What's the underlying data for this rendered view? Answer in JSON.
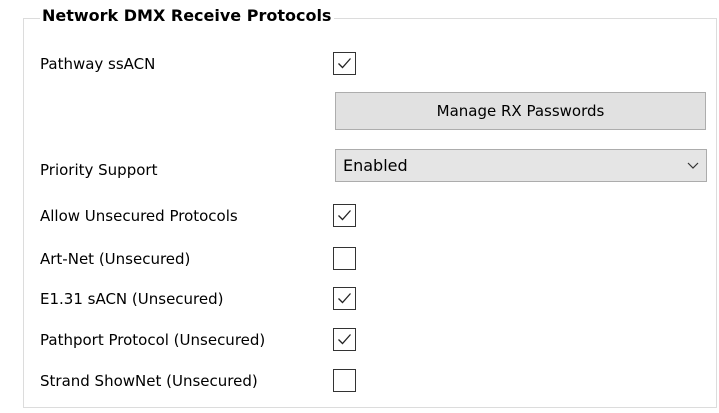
{
  "group": {
    "title": "Network DMX Receive Protocols"
  },
  "rows": {
    "pathway_ssacn": {
      "label": "Pathway ssACN",
      "checked": true
    },
    "manage_rx_passwords": {
      "label": "Manage RX Passwords"
    },
    "priority_support": {
      "label": "Priority Support",
      "value": "Enabled"
    },
    "allow_unsecured": {
      "label": "Allow Unsecured Protocols",
      "checked": true
    },
    "artnet": {
      "label": "Art-Net (Unsecured)",
      "checked": false
    },
    "e131": {
      "label": "E1.31 sACN (Unsecured)",
      "checked": true
    },
    "pathport": {
      "label": "Pathport Protocol (Unsecured)",
      "checked": true
    },
    "showsnet": {
      "label": "Strand ShowNet (Unsecured)",
      "checked": false
    }
  },
  "icons": {
    "checkmark": "check-icon",
    "dropdown": "chevron-down-icon"
  },
  "colors": {
    "button_bg": "#e1e1e1",
    "combo_bg": "#e5e5e5",
    "border": "#333333"
  }
}
